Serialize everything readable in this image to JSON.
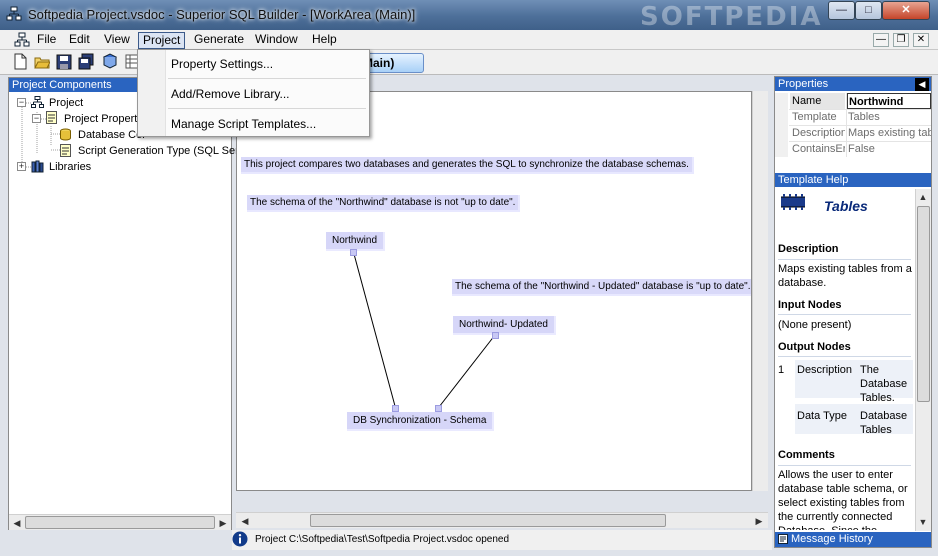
{
  "window": {
    "title": "Softpedia Project.vsdoc - Superior SQL Builder - [WorkArea (Main)]",
    "watermark": "SOFTPEDIA",
    "controls": [
      "minimize",
      "maximize",
      "close"
    ]
  },
  "menu": {
    "items": [
      "File",
      "Edit",
      "View",
      "Project",
      "Generate",
      "Window",
      "Help"
    ],
    "active": "Project"
  },
  "dropdown": {
    "items": [
      "Property Settings...",
      "Add/Remove Library...",
      "Manage Script Templates..."
    ]
  },
  "document_tab": {
    "label": "(Main)"
  },
  "project_components": {
    "header": "Project Components",
    "tree": [
      {
        "label": "Project",
        "level": 0,
        "expanded": true,
        "icon": "project-icon"
      },
      {
        "label": "Project Properties",
        "level": 1,
        "expanded": true,
        "icon": "properties-icon"
      },
      {
        "label": "Database Connections",
        "level": 2,
        "icon": "database-icon"
      },
      {
        "label": "Script Generation Type (SQL Server)",
        "level": 2,
        "icon": "script-icon"
      },
      {
        "label": "Libraries",
        "level": 0,
        "expanded": false,
        "icon": "library-icon"
      }
    ]
  },
  "canvas": {
    "notes": [
      "This project compares two databases and generates the SQL to synchronize the database schemas.",
      "The schema of the \"Northwind\" database is not \"up to date\".",
      "The schema of the \"Northwind - Updated\" database is \"up to date\"."
    ],
    "nodes": [
      "Northwind",
      "Northwind- Updated",
      "DB Synchronization - Schema"
    ]
  },
  "status": {
    "text": "Project C:\\Softpedia\\Test\\Softpedia Project.vsdoc opened"
  },
  "properties": {
    "header": "Properties",
    "rows": [
      {
        "key": "Name",
        "value": "Northwind",
        "bold": true
      },
      {
        "key": "Template",
        "value": "Tables"
      },
      {
        "key": "Description",
        "value": "Maps existing tables"
      },
      {
        "key": "ContainsErrors",
        "value": "False"
      }
    ]
  },
  "template_help": {
    "header": "Template Help",
    "title": "Tables",
    "description_heading": "Description",
    "description": "Maps existing tables from a database.",
    "input_heading": "Input Nodes",
    "input_text": "(None present)",
    "output_heading": "Output Nodes",
    "output_index": "1",
    "output_desc_key": "Description",
    "output_desc_val": "The Database Tables.",
    "output_type_key": "Data Type",
    "output_type_val": "Database Tables",
    "comments_heading": "Comments",
    "comments": "Allows the user to enter database table schema, or select existing tables from the currently connected Database. Since the"
  },
  "message_history": {
    "label": "Message History"
  },
  "colors": {
    "pane_header": "#2a64c0",
    "canvas_note": "#d9d9f9",
    "title_bar": "#4d6f99"
  }
}
